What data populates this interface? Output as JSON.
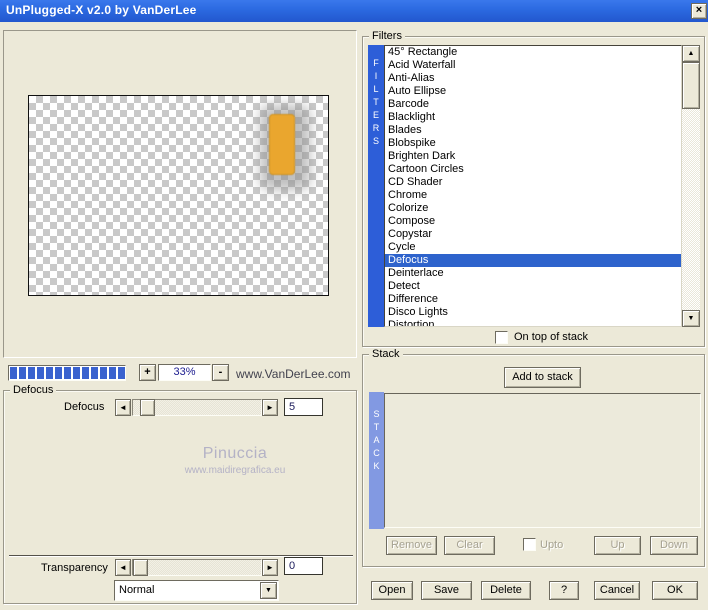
{
  "window": {
    "title": "UnPlugged-X v2.0 by VanDerLee"
  },
  "icons": {
    "close": "×",
    "left_arrow": "◄",
    "right_arrow": "►",
    "up_arrow": "▲",
    "down_arrow": "▼"
  },
  "preview": {
    "zoom_in": "+",
    "zoom_out": "-",
    "zoom_level": "33%",
    "brand": "www.VanDerLee.com",
    "watermark": {
      "name": "Pinuccia",
      "site": "www.maidiregrafica.eu"
    }
  },
  "filters": {
    "label": "Filters",
    "strip": "FILTERS",
    "items": [
      "45° Rectangle",
      "Acid Waterfall",
      "Anti-Alias",
      "Auto Ellipse",
      "Barcode",
      "Blacklight",
      "Blades",
      "Blobspike",
      "Brighten Dark",
      "Cartoon Circles",
      "CD Shader",
      "Chrome",
      "Colorize",
      "Compose",
      "Copystar",
      "Cycle",
      "Defocus",
      "Deinterlace",
      "Detect",
      "Difference",
      "Disco Lights",
      "Distortion"
    ],
    "selected_index": 16,
    "on_top_checkbox": "On top of stack"
  },
  "defocus_panel": {
    "label": "Defocus",
    "slider_label": "Defocus",
    "slider_value": "5",
    "transparency_label": "Transparency",
    "transparency_value": "0",
    "blend_mode": "Normal"
  },
  "stack_panel": {
    "label": "Stack",
    "strip": "STACK",
    "add_button": "Add to stack",
    "remove_button": "Remove",
    "clear_button": "Clear",
    "upto_checkbox": "Upto",
    "up_button": "Up",
    "down_button": "Down"
  },
  "footer": {
    "open": "Open",
    "save": "Save",
    "delete": "Delete",
    "help": "?",
    "cancel": "Cancel",
    "ok": "OK"
  },
  "colors": {
    "titlebar": "#2b69e0",
    "dialog_bg": "#ece9d8",
    "selection": "#2e63cc",
    "filters_strip": "#2d5ed8",
    "stack_strip": "#8299e2",
    "progress": "#3a62cf",
    "accent_orange": "#eaa62e"
  }
}
